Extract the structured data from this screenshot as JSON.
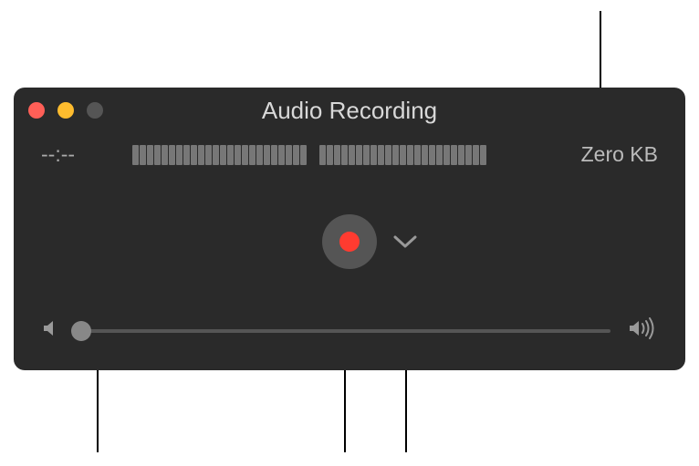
{
  "window": {
    "title": "Audio Recording",
    "time_display": "--:--",
    "filesize_display": "Zero KB"
  },
  "volume": {
    "value": 0
  },
  "level_meter": {
    "segments": 48
  },
  "traffic_lights": {
    "close": "#ff5f57",
    "minimize": "#febc2e",
    "maximize": "#555555"
  }
}
